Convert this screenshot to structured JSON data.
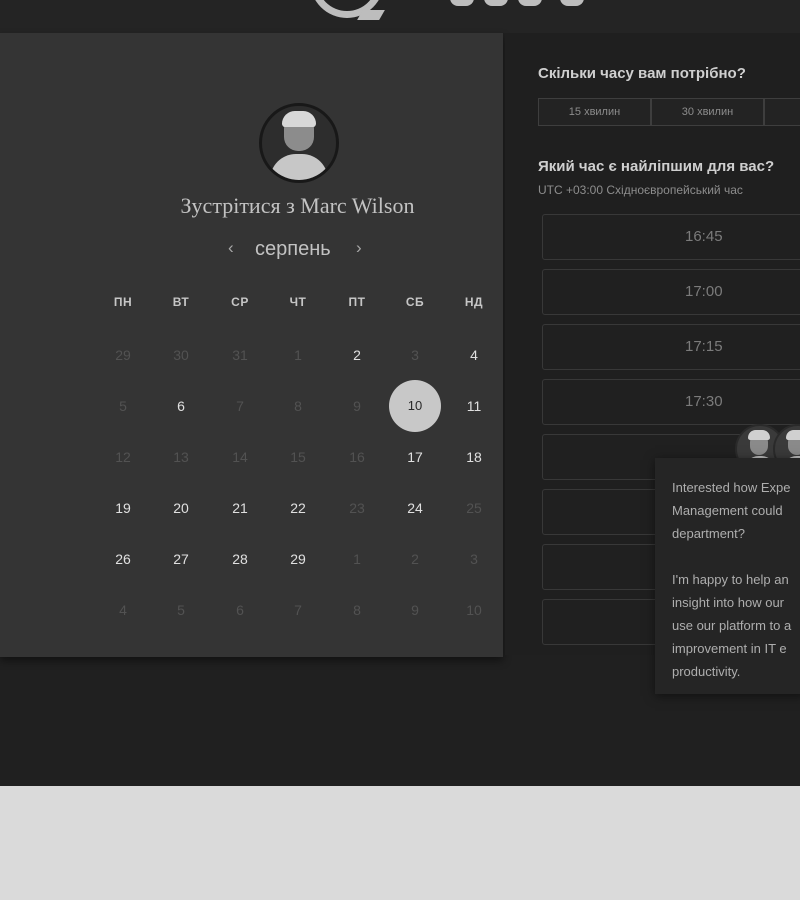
{
  "meeting": {
    "title": "Зустрітися з Marc Wilson",
    "month": "серпень",
    "prev_symbol": "‹",
    "next_symbol": "›"
  },
  "calendar": {
    "weekdays": [
      "ПН",
      "ВТ",
      "СР",
      "ЧТ",
      "ПТ",
      "СБ",
      "НД"
    ],
    "weeks": [
      [
        {
          "d": "29",
          "muted": true
        },
        {
          "d": "30",
          "muted": true
        },
        {
          "d": "31",
          "muted": true
        },
        {
          "d": "1",
          "muted": true
        },
        {
          "d": "2",
          "muted": false
        },
        {
          "d": "3",
          "muted": true
        },
        {
          "d": "4",
          "muted": false
        }
      ],
      [
        {
          "d": "5",
          "muted": true
        },
        {
          "d": "6",
          "muted": false
        },
        {
          "d": "7",
          "muted": true
        },
        {
          "d": "8",
          "muted": true
        },
        {
          "d": "9",
          "muted": true
        },
        {
          "d": "10",
          "muted": false,
          "selected": true
        },
        {
          "d": "11",
          "muted": false
        }
      ],
      [
        {
          "d": "12",
          "muted": true
        },
        {
          "d": "13",
          "muted": true
        },
        {
          "d": "14",
          "muted": true
        },
        {
          "d": "15",
          "muted": true
        },
        {
          "d": "16",
          "muted": true
        },
        {
          "d": "17",
          "muted": false
        },
        {
          "d": "18",
          "muted": false
        }
      ],
      [
        {
          "d": "19",
          "muted": false
        },
        {
          "d": "20",
          "muted": false
        },
        {
          "d": "21",
          "muted": false
        },
        {
          "d": "22",
          "muted": false
        },
        {
          "d": "23",
          "muted": true
        },
        {
          "d": "24",
          "muted": false
        },
        {
          "d": "25",
          "muted": true
        }
      ],
      [
        {
          "d": "26",
          "muted": false
        },
        {
          "d": "27",
          "muted": false
        },
        {
          "d": "28",
          "muted": false
        },
        {
          "d": "29",
          "muted": false
        },
        {
          "d": "1",
          "muted": true
        },
        {
          "d": "2",
          "muted": true
        },
        {
          "d": "3",
          "muted": true
        }
      ],
      [
        {
          "d": "4",
          "muted": true
        },
        {
          "d": "5",
          "muted": true
        },
        {
          "d": "6",
          "muted": true
        },
        {
          "d": "7",
          "muted": true
        },
        {
          "d": "8",
          "muted": true
        },
        {
          "d": "9",
          "muted": true
        },
        {
          "d": "10",
          "muted": true
        }
      ]
    ]
  },
  "scheduler": {
    "duration_question": "Скільки часу вам потрібно?",
    "durations": [
      "15 хвилин",
      "30 хвилин",
      ""
    ],
    "time_question": "Який час є найліпшим для вас?",
    "timezone": "UTC +03:00 Східноєвропейський час",
    "slots": [
      "16:45",
      "17:00",
      "17:15",
      "17:30",
      "",
      "",
      "",
      ""
    ]
  },
  "chat": {
    "paragraph1": "Interested how Expe\nManagement could \ndepartment?",
    "paragraph2": "I'm happy to help an\ninsight into how our\nuse our platform to a\nimprovement in IT e\nproductivity."
  }
}
